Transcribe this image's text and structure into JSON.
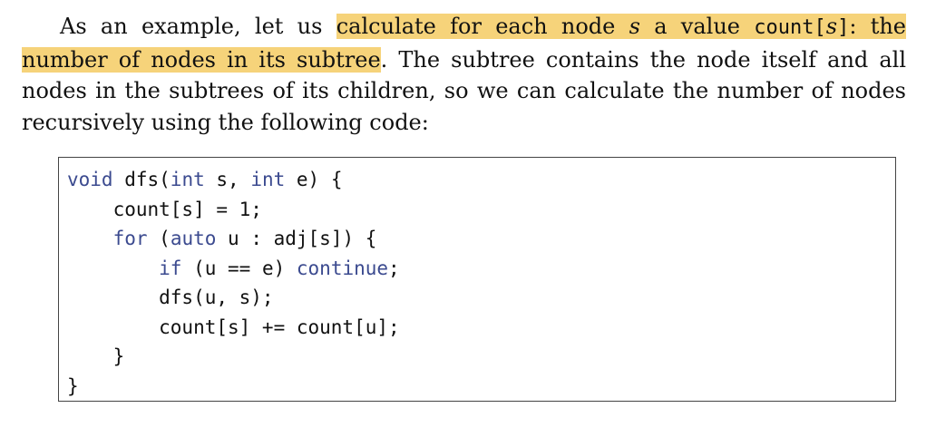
{
  "paragraph": {
    "part1": "As an example, let us ",
    "hl1_text1": "calculate for each node ",
    "hl1_var": "s",
    "hl1_text2": " a value ",
    "hl1_code": "count[",
    "hl1_var2": "s",
    "hl1_code_end": "]",
    "hl1_text3": ": the number of nodes in its subtree",
    "part2": ". The subtree contains the node itself and all nodes in the subtrees of its children, so we can calculate the number of nodes recursively using the following code:"
  },
  "code": {
    "l1_kw1": "void",
    "l1_a": " dfs(",
    "l1_kw2": "int",
    "l1_b": " s, ",
    "l1_kw3": "int",
    "l1_c": " e) {",
    "l2": "    count[s] = 1;",
    "l3_indent": "    ",
    "l3_kw1": "for",
    "l3_a": " (",
    "l3_kw2": "auto",
    "l3_b": " u : adj[s]) {",
    "l4_indent": "        ",
    "l4_kw1": "if",
    "l4_a": " (u == e) ",
    "l4_kw2": "continue",
    "l4_b": ";",
    "l5": "        dfs(u, s);",
    "l6": "        count[s] += count[u];",
    "l7": "    }",
    "l8": "}"
  },
  "colors": {
    "highlight": "#f6d37a",
    "keyword": "#3b4a8f",
    "text": "#111111",
    "border": "#444444"
  }
}
